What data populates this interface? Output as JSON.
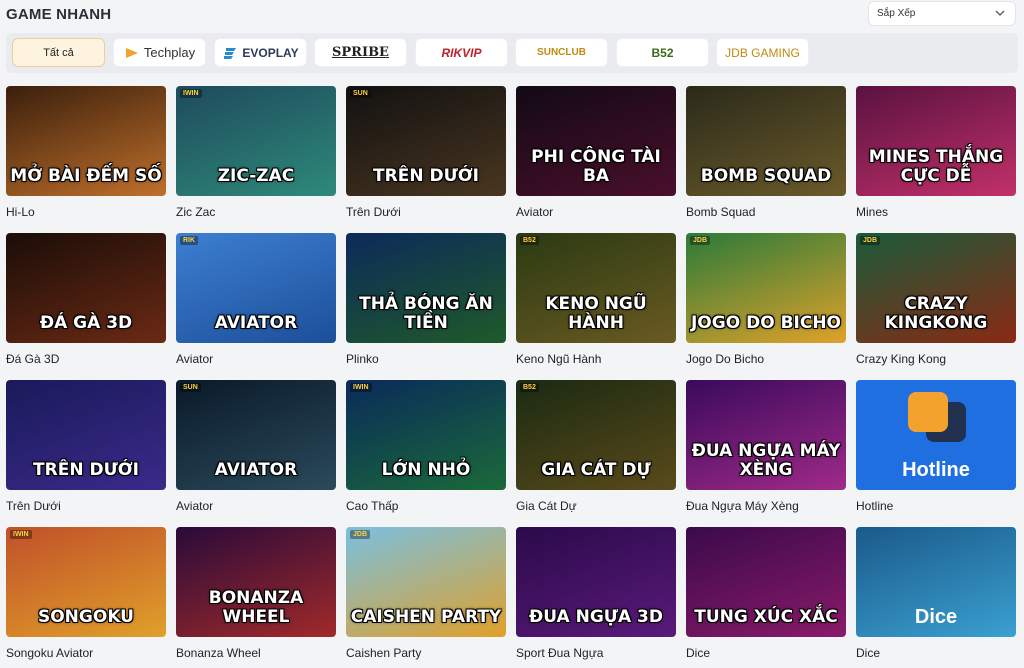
{
  "header": {
    "title": "GAME NHANH",
    "sort_label": "Sắp Xếp"
  },
  "providers": [
    {
      "label": "Tất cả",
      "active": true
    },
    {
      "label": "Techplay",
      "icon": "techplay-logo-icon"
    },
    {
      "label": "EVOPLAY",
      "icon": "evoplay-logo-icon"
    },
    {
      "label": "SPRIBE"
    },
    {
      "label": "RIKVIP"
    },
    {
      "label": "SUNCLUB"
    },
    {
      "label": "B52"
    },
    {
      "label": "JDB GAMING"
    }
  ],
  "games": [
    {
      "name": "Hi-Lo",
      "art": "MỞ BÀI ĐẾM SỐ",
      "brand": "",
      "colors": [
        "#3a1f0c",
        "#c0702b"
      ]
    },
    {
      "name": "Zic Zac",
      "art": "ZIC-ZAC",
      "brand": "IWIN",
      "colors": [
        "#1e4a5c",
        "#2e8a7a"
      ]
    },
    {
      "name": "Trên Dưới",
      "art": "TRÊN DƯỚI",
      "brand": "SUN",
      "colors": [
        "#111111",
        "#4a3620"
      ]
    },
    {
      "name": "Aviator",
      "art": "PHI CÔNG TÀI BA",
      "brand": "",
      "colors": [
        "#120a14",
        "#4a0f2c"
      ]
    },
    {
      "name": "Bomb Squad",
      "art": "BOMB SQUAD",
      "brand": "",
      "colors": [
        "#2a2a1a",
        "#6b5a2a"
      ]
    },
    {
      "name": "Mines",
      "art": "MINES THẮNG CỰC DỄ",
      "brand": "",
      "colors": [
        "#5a1240",
        "#c2306a"
      ]
    },
    {
      "name": "Đá Gà 3D",
      "art": "ĐÁ GÀ 3D",
      "brand": "",
      "colors": [
        "#1a0d08",
        "#6b2a14"
      ]
    },
    {
      "name": "Aviator",
      "art": "AVIATOR",
      "brand": "RIK",
      "colors": [
        "#3d7fd0",
        "#1c4f9a"
      ]
    },
    {
      "name": "Plinko",
      "art": "THẢ BÓNG ĂN TIỀN",
      "brand": "",
      "colors": [
        "#0c2a5a",
        "#1f5a2a"
      ]
    },
    {
      "name": "Keno Ngũ Hành",
      "art": "KENO NGŨ HÀNH",
      "brand": "B52",
      "colors": [
        "#2a3a12",
        "#6a5a22"
      ]
    },
    {
      "name": "Jogo Do Bicho",
      "art": "JOGO DO BICHO",
      "brand": "JDB",
      "colors": [
        "#2a7a3a",
        "#e0a22a"
      ]
    },
    {
      "name": "Crazy King Kong",
      "art": "CRAZY KINGKONG",
      "brand": "JDB",
      "colors": [
        "#1a5a3a",
        "#8a2a14"
      ]
    },
    {
      "name": "Trên Dưới",
      "art": "TRÊN DƯỚI",
      "brand": "",
      "colors": [
        "#1a1a5a",
        "#3a2a8a"
      ]
    },
    {
      "name": "Aviator",
      "art": "AVIATOR",
      "brand": "SUN",
      "colors": [
        "#0a1a2a",
        "#2a4a5a"
      ]
    },
    {
      "name": "Cao Thấp",
      "art": "LỚN NHỎ",
      "brand": "IWIN",
      "colors": [
        "#0a2a5a",
        "#1a6a3a"
      ]
    },
    {
      "name": "Gia Cát Dự",
      "art": "GIA CÁT DỰ",
      "brand": "B52",
      "colors": [
        "#1a2a12",
        "#5a4a1a"
      ]
    },
    {
      "name": "Đua Ngựa Máy Xèng",
      "art": "ĐUA NGỰA MÁY XÈNG",
      "brand": "",
      "colors": [
        "#3a0a5a",
        "#a02a8a"
      ]
    },
    {
      "name": "Hotline",
      "art": "Hotline",
      "brand": "",
      "colors": [
        "#1f6fe0",
        "#1f6fe0"
      ]
    },
    {
      "name": "Songoku Aviator",
      "art": "SONGOKU",
      "brand": "IWIN",
      "colors": [
        "#c0502a",
        "#e0a02a"
      ]
    },
    {
      "name": "Bonanza Wheel",
      "art": "BONANZA WHEEL",
      "brand": "",
      "colors": [
        "#2a0a3a",
        "#a02a2a"
      ]
    },
    {
      "name": "Caishen Party",
      "art": "CAISHEN PARTY",
      "brand": "JDB",
      "colors": [
        "#7ac0e0",
        "#e0a02a"
      ]
    },
    {
      "name": "Sport Đua Ngựa",
      "art": "ĐUA NGỰA 3D",
      "brand": "",
      "colors": [
        "#2a0a4a",
        "#5a1a7a"
      ]
    },
    {
      "name": "Dice",
      "art": "TUNG XÚC XẮC",
      "brand": "",
      "colors": [
        "#3a0a4a",
        "#8a1a6a"
      ]
    },
    {
      "name": "Dice",
      "art": "Dice",
      "brand": "",
      "colors": [
        "#1a5a8a",
        "#3aa0d0"
      ]
    }
  ]
}
